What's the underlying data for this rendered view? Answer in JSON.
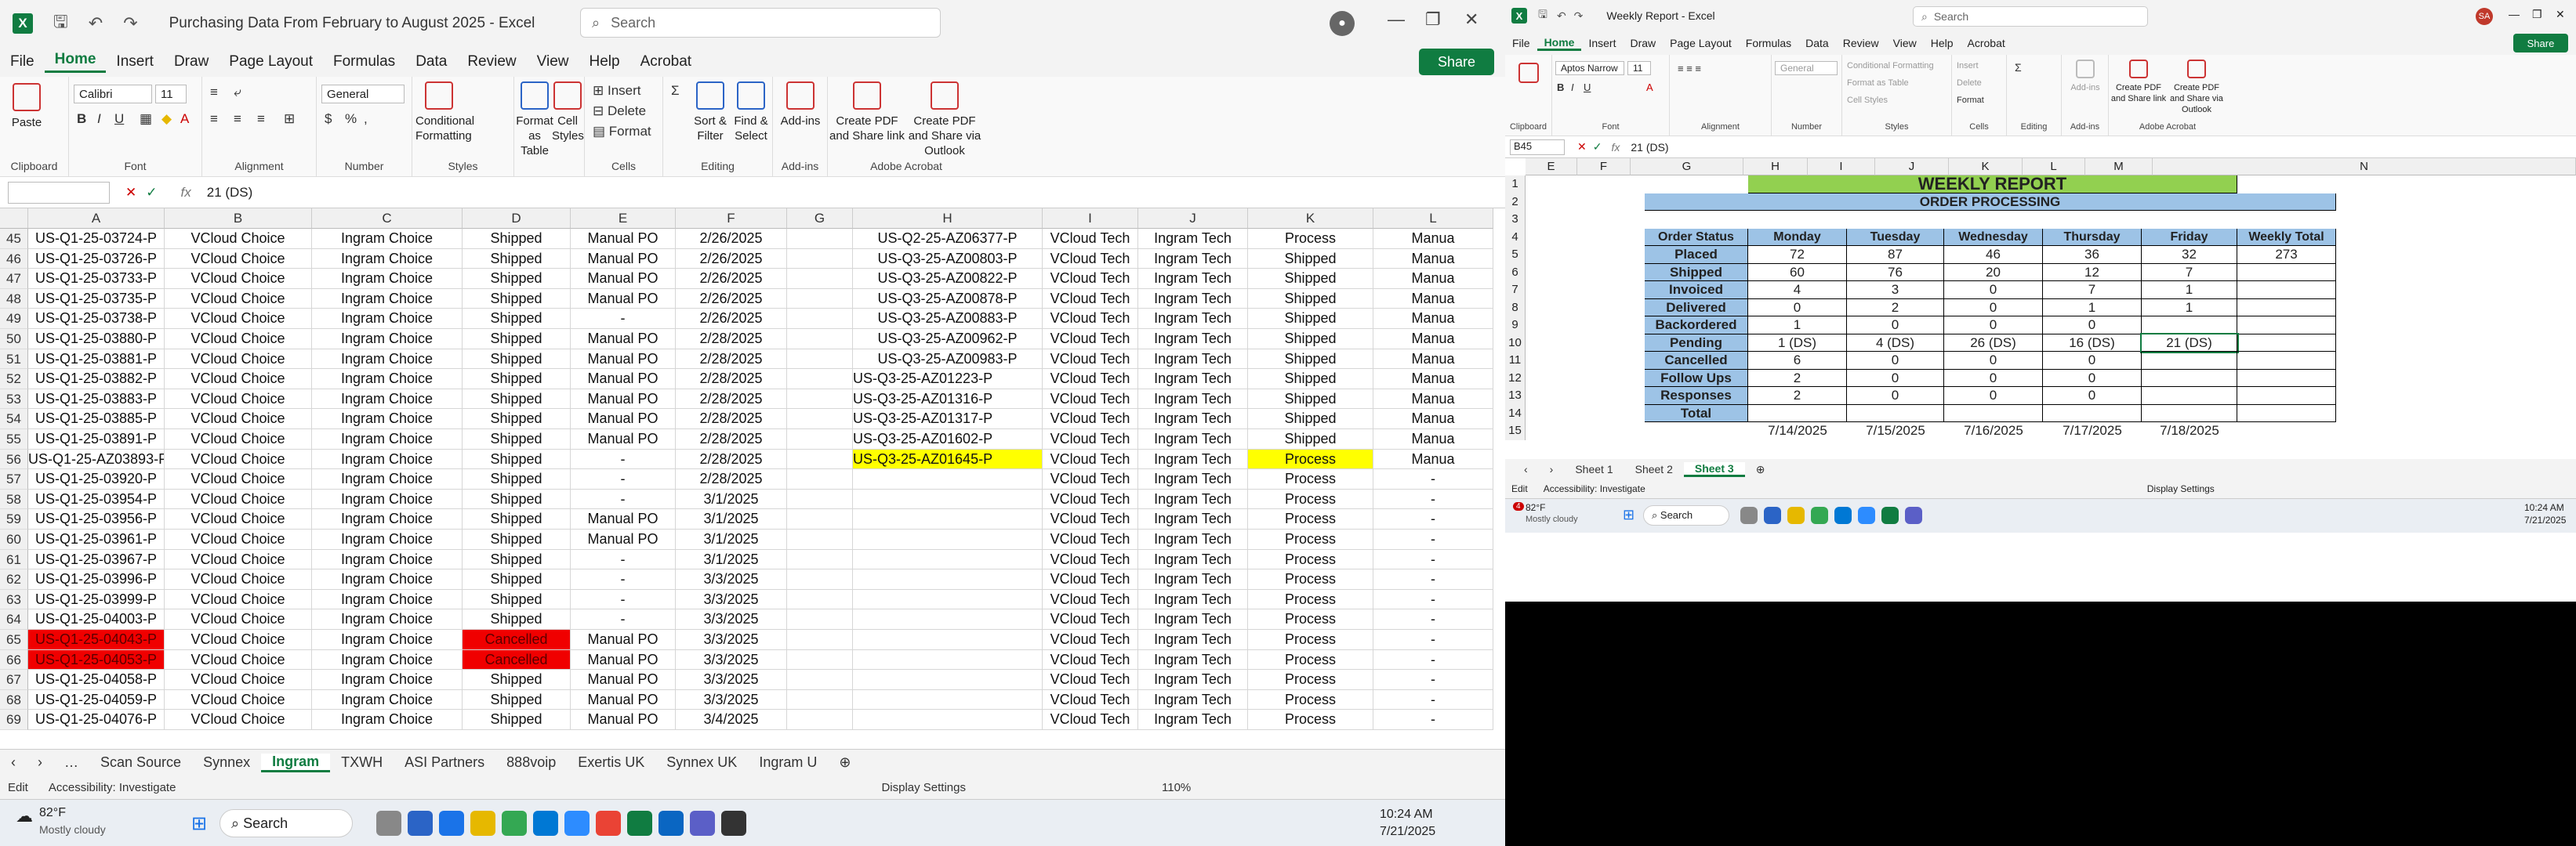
{
  "left": {
    "title": "Purchasing Data From February to August 2025  -  Excel",
    "search_placeholder": "Search",
    "menu": [
      "File",
      "Home",
      "Insert",
      "Draw",
      "Page Layout",
      "Formulas",
      "Data",
      "Review",
      "View",
      "Help",
      "Acrobat"
    ],
    "share_label": "Share",
    "ribbon": {
      "clipboard": "Clipboard",
      "paste": "Paste",
      "font_group": "Font",
      "font_name": "Calibri",
      "font_size": "11",
      "alignment": "Alignment",
      "number_group": "Number",
      "number_format": "General",
      "styles": "Styles",
      "cond_format": "Conditional Formatting",
      "format_table": "Format as Table",
      "cell_styles": "Cell Styles",
      "cells": "Cells",
      "insert": "Insert",
      "delete": "Delete",
      "format": "Format",
      "editing": "Editing",
      "sort_filter": "Sort & Filter",
      "find_select": "Find & Select",
      "addins_group": "Add-ins",
      "addins": "Add-ins",
      "acrobat_group": "Adobe Acrobat",
      "pdf_share": "Create PDF and Share link",
      "pdf_outlook": "Create PDF and Share via Outlook"
    },
    "namebox": "",
    "formula": "21 (DS)",
    "columns": [
      "A",
      "B",
      "C",
      "D",
      "E",
      "F",
      "G",
      "H",
      "I",
      "J",
      "K",
      "L"
    ],
    "rows": [
      {
        "n": "45",
        "a": "US-Q1-25-03724-P",
        "b": "VCloud Choice",
        "c": "Ingram Choice",
        "d": "Shipped",
        "e": "Manual PO",
        "f": "2/26/2025",
        "h": "US-Q2-25-AZ06377-P",
        "i": "VCloud Tech",
        "j": "Ingram Tech",
        "k": "Process",
        "l": "Manua"
      },
      {
        "n": "46",
        "a": "US-Q1-25-03726-P",
        "b": "VCloud Choice",
        "c": "Ingram Choice",
        "d": "Shipped",
        "e": "Manual PO",
        "f": "2/26/2025",
        "h": "US-Q3-25-AZ00803-P",
        "i": "VCloud Tech",
        "j": "Ingram Tech",
        "k": "Shipped",
        "l": "Manua"
      },
      {
        "n": "47",
        "a": "US-Q1-25-03733-P",
        "b": "VCloud Choice",
        "c": "Ingram Choice",
        "d": "Shipped",
        "e": "Manual PO",
        "f": "2/26/2025",
        "h": "US-Q3-25-AZ00822-P",
        "i": "VCloud Tech",
        "j": "Ingram Tech",
        "k": "Shipped",
        "l": "Manua"
      },
      {
        "n": "48",
        "a": "US-Q1-25-03735-P",
        "b": "VCloud Choice",
        "c": "Ingram Choice",
        "d": "Shipped",
        "e": "Manual PO",
        "f": "2/26/2025",
        "h": "US-Q3-25-AZ00878-P",
        "i": "VCloud Tech",
        "j": "Ingram Tech",
        "k": "Shipped",
        "l": "Manua"
      },
      {
        "n": "49",
        "a": "US-Q1-25-03738-P",
        "b": "VCloud Choice",
        "c": "Ingram Choice",
        "d": "Shipped",
        "e": "-",
        "f": "2/26/2025",
        "h": "US-Q3-25-AZ00883-P",
        "i": "VCloud Tech",
        "j": "Ingram Tech",
        "k": "Shipped",
        "l": "Manua"
      },
      {
        "n": "50",
        "a": "US-Q1-25-03880-P",
        "b": "VCloud Choice",
        "c": "Ingram Choice",
        "d": "Shipped",
        "e": "Manual PO",
        "f": "2/28/2025",
        "h": "US-Q3-25-AZ00962-P",
        "i": "VCloud Tech",
        "j": "Ingram Tech",
        "k": "Shipped",
        "l": "Manua"
      },
      {
        "n": "51",
        "a": "US-Q1-25-03881-P",
        "b": "VCloud Choice",
        "c": "Ingram Choice",
        "d": "Shipped",
        "e": "Manual PO",
        "f": "2/28/2025",
        "h": "US-Q3-25-AZ00983-P",
        "i": "VCloud Tech",
        "j": "Ingram Tech",
        "k": "Shipped",
        "l": "Manua"
      },
      {
        "n": "52",
        "a": "US-Q1-25-03882-P",
        "b": "VCloud Choice",
        "c": "Ingram Choice",
        "d": "Shipped",
        "e": "Manual PO",
        "f": "2/28/2025",
        "h": "US-Q3-25-AZ01223-P",
        "i": "VCloud Tech",
        "j": "Ingram Tech",
        "k": "Shipped",
        "l": "Manua"
      },
      {
        "n": "53",
        "a": "US-Q1-25-03883-P",
        "b": "VCloud Choice",
        "c": "Ingram Choice",
        "d": "Shipped",
        "e": "Manual PO",
        "f": "2/28/2025",
        "h": "US-Q3-25-AZ01316-P",
        "i": "VCloud Tech",
        "j": "Ingram Tech",
        "k": "Shipped",
        "l": "Manua"
      },
      {
        "n": "54",
        "a": "US-Q1-25-03885-P",
        "b": "VCloud Choice",
        "c": "Ingram Choice",
        "d": "Shipped",
        "e": "Manual PO",
        "f": "2/28/2025",
        "h": "US-Q3-25-AZ01317-P",
        "i": "VCloud Tech",
        "j": "Ingram Tech",
        "k": "Shipped",
        "l": "Manua"
      },
      {
        "n": "55",
        "a": "US-Q1-25-03891-P",
        "b": "VCloud Choice",
        "c": "Ingram Choice",
        "d": "Shipped",
        "e": "Manual PO",
        "f": "2/28/2025",
        "h": "US-Q3-25-AZ01602-P",
        "i": "VCloud Tech",
        "j": "Ingram Tech",
        "k": "Shipped",
        "l": "Manua"
      },
      {
        "n": "56",
        "a": "US-Q1-25-AZ03893-P",
        "b": "VCloud Choice",
        "c": "Ingram Choice",
        "d": "Shipped",
        "e": "-",
        "f": "2/28/2025",
        "h": "US-Q3-25-AZ01645-P",
        "i": "VCloud Tech",
        "j": "Ingram Tech",
        "k": "Process",
        "l": "Manua"
      },
      {
        "n": "57",
        "a": "US-Q1-25-03920-P",
        "b": "VCloud Choice",
        "c": "Ingram Choice",
        "d": "Shipped",
        "e": "-",
        "f": "2/28/2025",
        "h": "",
        "i": "VCloud Tech",
        "j": "Ingram Tech",
        "k": "Process",
        "l": "-"
      },
      {
        "n": "58",
        "a": "US-Q1-25-03954-P",
        "b": "VCloud Choice",
        "c": "Ingram Choice",
        "d": "Shipped",
        "e": "-",
        "f": "3/1/2025",
        "h": "",
        "i": "VCloud Tech",
        "j": "Ingram Tech",
        "k": "Process",
        "l": "-"
      },
      {
        "n": "59",
        "a": "US-Q1-25-03956-P",
        "b": "VCloud Choice",
        "c": "Ingram Choice",
        "d": "Shipped",
        "e": "Manual PO",
        "f": "3/1/2025",
        "h": "",
        "i": "VCloud Tech",
        "j": "Ingram Tech",
        "k": "Process",
        "l": "-"
      },
      {
        "n": "60",
        "a": "US-Q1-25-03961-P",
        "b": "VCloud Choice",
        "c": "Ingram Choice",
        "d": "Shipped",
        "e": "Manual PO",
        "f": "3/1/2025",
        "h": "",
        "i": "VCloud Tech",
        "j": "Ingram Tech",
        "k": "Process",
        "l": "-"
      },
      {
        "n": "61",
        "a": "US-Q1-25-03967-P",
        "b": "VCloud Choice",
        "c": "Ingram Choice",
        "d": "Shipped",
        "e": "-",
        "f": "3/1/2025",
        "h": "",
        "i": "VCloud Tech",
        "j": "Ingram Tech",
        "k": "Process",
        "l": "-"
      },
      {
        "n": "62",
        "a": "US-Q1-25-03996-P",
        "b": "VCloud Choice",
        "c": "Ingram Choice",
        "d": "Shipped",
        "e": "-",
        "f": "3/3/2025",
        "h": "",
        "i": "VCloud Tech",
        "j": "Ingram Tech",
        "k": "Process",
        "l": "-"
      },
      {
        "n": "63",
        "a": "US-Q1-25-03999-P",
        "b": "VCloud Choice",
        "c": "Ingram Choice",
        "d": "Shipped",
        "e": "-",
        "f": "3/3/2025",
        "h": "",
        "i": "VCloud Tech",
        "j": "Ingram Tech",
        "k": "Process",
        "l": "-"
      },
      {
        "n": "64",
        "a": "US-Q1-25-04003-P",
        "b": "VCloud Choice",
        "c": "Ingram Choice",
        "d": "Shipped",
        "e": "-",
        "f": "3/3/2025",
        "h": "",
        "i": "VCloud Tech",
        "j": "Ingram Tech",
        "k": "Process",
        "l": "-"
      },
      {
        "n": "65",
        "a": "US-Q1-25-04043-P",
        "b": "VCloud Choice",
        "c": "Ingram Choice",
        "d": "Cancelled",
        "e": "Manual PO",
        "f": "3/3/2025",
        "h": "",
        "i": "VCloud Tech",
        "j": "Ingram Tech",
        "k": "Process",
        "l": "-"
      },
      {
        "n": "66",
        "a": "US-Q1-25-04053-P",
        "b": "VCloud Choice",
        "c": "Ingram Choice",
        "d": "Cancelled",
        "e": "Manual PO",
        "f": "3/3/2025",
        "h": "",
        "i": "VCloud Tech",
        "j": "Ingram Tech",
        "k": "Process",
        "l": "-"
      },
      {
        "n": "67",
        "a": "US-Q1-25-04058-P",
        "b": "VCloud Choice",
        "c": "Ingram Choice",
        "d": "Shipped",
        "e": "Manual PO",
        "f": "3/3/2025",
        "h": "",
        "i": "VCloud Tech",
        "j": "Ingram Tech",
        "k": "Process",
        "l": "-"
      },
      {
        "n": "68",
        "a": "US-Q1-25-04059-P",
        "b": "VCloud Choice",
        "c": "Ingram Choice",
        "d": "Shipped",
        "e": "Manual PO",
        "f": "3/3/2025",
        "h": "",
        "i": "VCloud Tech",
        "j": "Ingram Tech",
        "k": "Process",
        "l": "-"
      },
      {
        "n": "69",
        "a": "US-Q1-25-04076-P",
        "b": "VCloud Choice",
        "c": "Ingram Choice",
        "d": "Shipped",
        "e": "Manual PO",
        "f": "3/4/2025",
        "h": "",
        "i": "VCloud Tech",
        "j": "Ingram Tech",
        "k": "Process",
        "l": "-"
      }
    ],
    "tabs": [
      "Scan Source",
      "Synnex",
      "Ingram",
      "TXWH",
      "ASI Partners",
      "888voip",
      "Exertis UK",
      "Synnex UK",
      "Ingram U"
    ],
    "active_tab": "Ingram",
    "status": {
      "mode": "Edit",
      "accessibility": "Accessibility: Investigate",
      "display": "Display Settings",
      "zoom": "110%"
    },
    "weather": {
      "temp": "82°F",
      "cond": "Mostly cloudy"
    },
    "taskbar_search": "Search",
    "clock": {
      "time": "10:24 AM",
      "date": "7/21/2025"
    }
  },
  "right": {
    "title": "Weekly Report  -  Excel",
    "search_placeholder": "Search",
    "avatar": "SA",
    "menu": [
      "File",
      "Home",
      "Insert",
      "Draw",
      "Page Layout",
      "Formulas",
      "Data",
      "Review",
      "View",
      "Help",
      "Acrobat"
    ],
    "share_label": "Share",
    "ribbon": {
      "clipboard": "Clipboard",
      "font_group": "Font",
      "font_name": "Aptos Narrow",
      "font_size": "11",
      "alignment": "Alignment",
      "number_group": "Number",
      "number_format": "General",
      "styles": "Styles",
      "cond_format": "Conditional Formatting",
      "format_table": "Format as Table",
      "cell_styles": "Cell Styles",
      "cells": "Cells",
      "insert": "Insert",
      "delete": "Delete",
      "format": "Format",
      "editing": "Editing",
      "addins_group": "Add-ins",
      "addins": "Add-ins",
      "acrobat_group": "Adobe Acrobat",
      "pdf_share": "Create PDF and Share link",
      "pdf_outlook": "Create PDF and Share via Outlook"
    },
    "namebox": "B45",
    "formula": "21 (DS)",
    "columns": [
      "E",
      "F",
      "G",
      "H",
      "I",
      "J",
      "K",
      "L",
      "M",
      "N"
    ],
    "row_numbers": [
      "1",
      "2",
      "3",
      "4",
      "5",
      "6",
      "7",
      "8",
      "9",
      "10",
      "11",
      "12",
      "13",
      "14",
      "15"
    ],
    "report_title": "WEEKLY REPORT",
    "report_sub": "ORDER PROCESSING",
    "headers": [
      "Order Status",
      "Monday",
      "Tuesday",
      "Wednesday",
      "Thursday",
      "Friday",
      "Weekly Total"
    ],
    "table": [
      {
        "label": "Placed",
        "v": [
          "72",
          "87",
          "46",
          "36",
          "32",
          "273"
        ]
      },
      {
        "label": "Shipped",
        "v": [
          "60",
          "76",
          "20",
          "12",
          "7",
          ""
        ]
      },
      {
        "label": "Invoiced",
        "v": [
          "4",
          "3",
          "0",
          "7",
          "1",
          ""
        ]
      },
      {
        "label": "Delivered",
        "v": [
          "0",
          "2",
          "0",
          "1",
          "1",
          ""
        ]
      },
      {
        "label": "Backordered",
        "v": [
          "1",
          "0",
          "0",
          "0",
          "",
          ""
        ]
      },
      {
        "label": "Pending",
        "v": [
          "1 (DS)",
          "4 (DS)",
          "26 (DS)",
          "16 (DS)",
          "21 (DS)",
          ""
        ]
      },
      {
        "label": "Cancelled",
        "v": [
          "6",
          "0",
          "0",
          "0",
          "",
          ""
        ]
      },
      {
        "label": "Follow Ups",
        "v": [
          "2",
          "0",
          "0",
          "0",
          "",
          ""
        ]
      },
      {
        "label": "Responses",
        "v": [
          "2",
          "0",
          "0",
          "0",
          "",
          ""
        ]
      },
      {
        "label": "Total",
        "v": [
          "",
          "",
          "",
          "",
          "",
          ""
        ]
      }
    ],
    "dates": [
      "7/14/2025",
      "7/15/2025",
      "7/16/2025",
      "7/17/2025",
      "7/18/2025"
    ],
    "tabs": [
      "Sheet 1",
      "Sheet 2",
      "Sheet 3"
    ],
    "active_tab": "Sheet 3",
    "status": {
      "mode": "Edit",
      "accessibility": "Accessibility: Investigate",
      "display": "Display Settings"
    },
    "weather": {
      "badge": "4",
      "temp": "82°F",
      "cond": "Mostly cloudy"
    },
    "taskbar_search": "Search",
    "clock": {
      "time": "10:24 AM",
      "date": "7/21/2025"
    }
  }
}
